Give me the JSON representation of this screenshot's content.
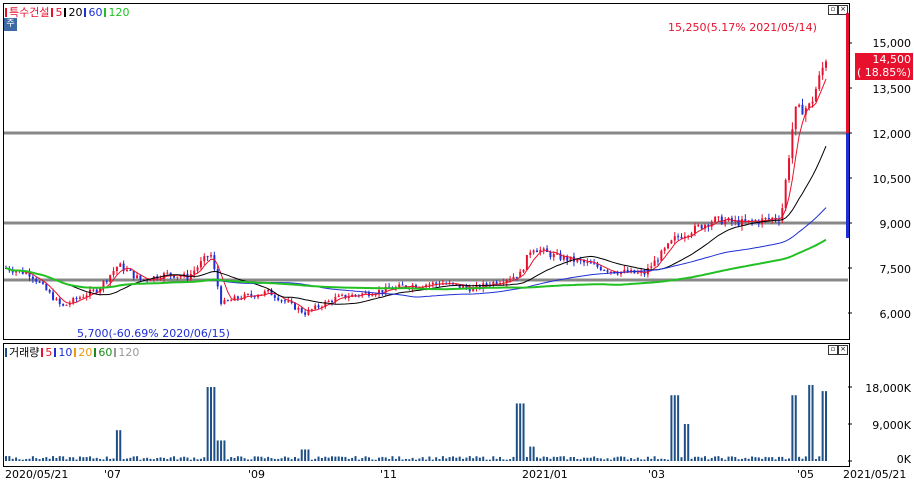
{
  "header": {
    "stock_name": "특수건설",
    "ma_legend": [
      {
        "label": "5",
        "color": "#e8112d"
      },
      {
        "label": "20",
        "color": "#000000"
      },
      {
        "label": "60",
        "color": "#1d2fd6"
      },
      {
        "label": "120",
        "color": "#22c022"
      }
    ],
    "mode_label": "주"
  },
  "volume_header": {
    "title": "거래량",
    "ma_legend": [
      {
        "label": "5",
        "color": "#e8112d"
      },
      {
        "label": "10",
        "color": "#1d2fd6"
      },
      {
        "label": "20",
        "color": "#e89a10"
      },
      {
        "label": "60",
        "color": "#1a8a1a"
      },
      {
        "label": "120",
        "color": "#999999"
      }
    ]
  },
  "annotations": {
    "high": "15,250(5.17% 2021/05/14)",
    "low": "5,700(-60.69% 2020/06/15)",
    "current_price": "14,500",
    "current_change": "( 18.85%)"
  },
  "price_axis": [
    "15,000",
    "13,500",
    "12,000",
    "10,500",
    "9,000",
    "7,500",
    "6,000"
  ],
  "volume_axis": [
    "18,000K",
    "9,000K",
    "0K"
  ],
  "x_axis": [
    "2020/05/21",
    "'07",
    "'09",
    "'11",
    "2021/01",
    "'03",
    "'05",
    "2021/05/21"
  ],
  "colors": {
    "up": "#e8112d",
    "down": "#1d2fd6",
    "ma5": "#e8112d",
    "ma20": "#000000",
    "ma60": "#1d2fd6",
    "ma120": "#22c022",
    "volume": "#1e4f86"
  },
  "chart_data": {
    "type": "candlestick",
    "xlabel": "",
    "ylabel": "",
    "ylim": [
      5400,
      16000
    ],
    "horizontal_lines": [
      12000,
      9000,
      7100
    ],
    "x": [
      "2020/05/21",
      "2020/07",
      "2020/09",
      "2020/11",
      "2021/01",
      "2021/03",
      "2021/05",
      "2021/05/21"
    ],
    "close_series": [
      [
        "2020/05/21",
        7500
      ],
      [
        "2020/06/01",
        7300
      ],
      [
        "2020/06/15",
        6200
      ],
      [
        "2020/06/22",
        6500
      ],
      [
        "2020/07/01",
        6800
      ],
      [
        "2020/07/10",
        7600
      ],
      [
        "2020/07/20",
        7100
      ],
      [
        "2020/08/01",
        7300
      ],
      [
        "2020/08/10",
        7200
      ],
      [
        "2020/08/20",
        8000
      ],
      [
        "2020/08/25",
        6300
      ],
      [
        "2020/09/01",
        6500
      ],
      [
        "2020/09/15",
        6700
      ],
      [
        "2020/10/01",
        6000
      ],
      [
        "2020/10/15",
        6500
      ],
      [
        "2020/11/01",
        6700
      ],
      [
        "2020/11/15",
        6900
      ],
      [
        "2020/12/01",
        7000
      ],
      [
        "2020/12/15",
        6800
      ],
      [
        "2021/01/05",
        7300
      ],
      [
        "2021/01/10",
        8200
      ],
      [
        "2021/01/20",
        7900
      ],
      [
        "2021/02/01",
        7700
      ],
      [
        "2021/02/15",
        7400
      ],
      [
        "2021/03/01",
        7300
      ],
      [
        "2021/03/15",
        8500
      ],
      [
        "2021/04/01",
        9100
      ],
      [
        "2021/04/15",
        9000
      ],
      [
        "2021/05/01",
        9200
      ],
      [
        "2021/05/07",
        12700
      ],
      [
        "2021/05/14",
        12900
      ],
      [
        "2021/05/21",
        14500
      ]
    ],
    "volume_series_k": [
      [
        "2020/05/21",
        1200
      ],
      [
        "2020/07/10",
        7500
      ],
      [
        "2020/08/20",
        18000
      ],
      [
        "2020/08/25",
        5000
      ],
      [
        "2020/10/01",
        2800
      ],
      [
        "2021/01/05",
        14000
      ],
      [
        "2021/01/10",
        3500
      ],
      [
        "2021/03/15",
        16000
      ],
      [
        "2021/03/20",
        9000
      ],
      [
        "2021/05/07",
        16000
      ],
      [
        "2021/05/14",
        18500
      ],
      [
        "2021/05/21",
        17000
      ]
    ]
  }
}
